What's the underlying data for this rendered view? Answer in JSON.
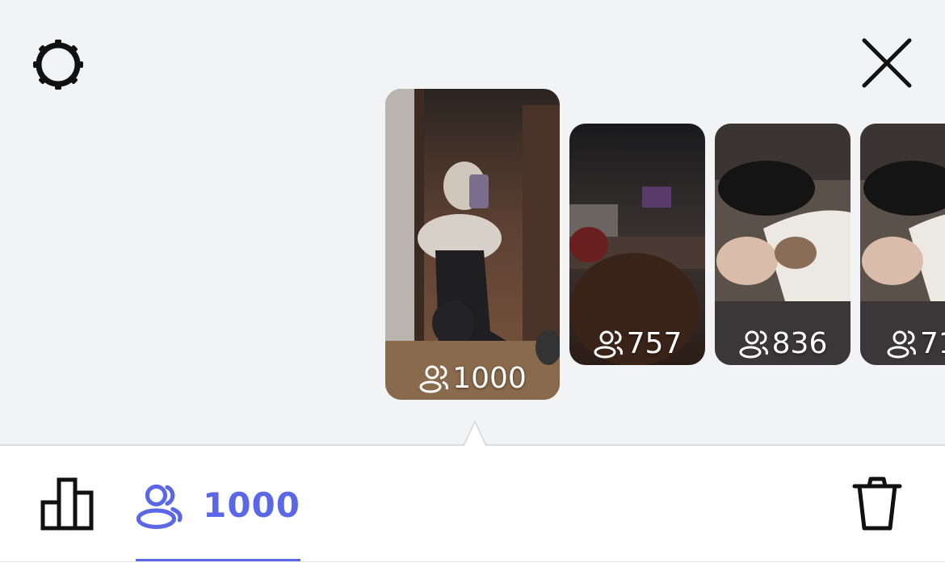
{
  "header": {
    "settings_icon": "gear-icon",
    "close_icon": "close-icon"
  },
  "stories": [
    {
      "viewers": "1000",
      "selected": true,
      "icon": "viewers-icon"
    },
    {
      "viewers": "757",
      "selected": false,
      "icon": "viewers-icon"
    },
    {
      "viewers": "836",
      "selected": false,
      "icon": "viewers-icon"
    },
    {
      "viewers": "71",
      "selected": false,
      "icon": "viewers-icon"
    }
  ],
  "bottom_bar": {
    "stats_icon": "bar-chart-icon",
    "viewers_icon": "viewers-icon",
    "viewers_count": "1000",
    "delete_icon": "trash-icon"
  },
  "colors": {
    "accent": "#5b67e6",
    "background": "#f2f3f5",
    "panel": "#ffffff",
    "icon": "#111111"
  }
}
